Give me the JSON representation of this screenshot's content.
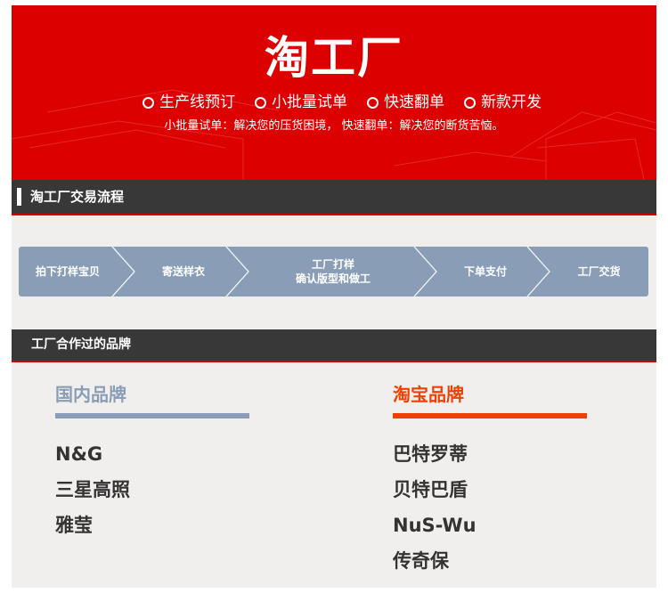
{
  "banner": {
    "logo": "淘工厂",
    "services": [
      "生产线预订",
      "小批量试单",
      "快速翻单",
      "新款开发"
    ],
    "tagline": "小批量试单：解决您的压货困境， 快速翻单：解决您的断货苦恼。",
    "background_color": "#dd0000"
  },
  "process_section": {
    "title": "淘工厂交易流程",
    "steps": [
      {
        "line1": "拍下打样宝贝",
        "line2": ""
      },
      {
        "line1": "寄送样衣",
        "line2": ""
      },
      {
        "line1": "工厂打样",
        "line2": "确认版型和做工"
      },
      {
        "line1": "下单支付",
        "line2": ""
      },
      {
        "line1": "工厂交货",
        "line2": ""
      }
    ],
    "step_color": "#8a9db6"
  },
  "brands_section": {
    "title": "工厂合作过的品牌",
    "domestic": {
      "title": "国内品牌",
      "color": "#8a9db6",
      "brands": [
        "N&G",
        "三星高照",
        "雅莹"
      ]
    },
    "taobao": {
      "title": "淘宝品牌",
      "color": "#ee4000",
      "brands": [
        "巴特罗蒂",
        "贝特巴盾",
        "NuS-Wu",
        "传奇保"
      ]
    }
  }
}
